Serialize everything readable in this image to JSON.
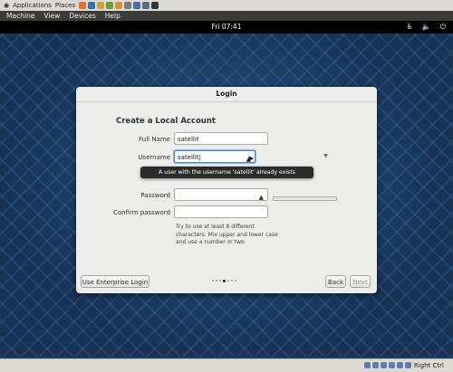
{
  "host_bar": {
    "applications": "Applications",
    "places": "Places",
    "launchers": [
      {
        "icon": "firefox-icon",
        "color": "#e2712a"
      },
      {
        "icon": "thunderbird-icon",
        "color": "#3a6fb0"
      },
      {
        "icon": "tool-icon",
        "color": "#c9a33a"
      },
      {
        "icon": "editor-icon",
        "color": "#6d9a3a"
      },
      {
        "icon": "folder-icon",
        "color": "#d7903b"
      },
      {
        "icon": "chat-icon",
        "color": "#7a7a7a"
      },
      {
        "icon": "window-icon",
        "color": "#4c6ca0"
      },
      {
        "icon": "network-icon",
        "color": "#5a6a8a"
      },
      {
        "icon": "terminal-icon",
        "color": "#333333"
      }
    ]
  },
  "vm_menu": {
    "items": [
      "Machine",
      "View",
      "Devices",
      "Help"
    ]
  },
  "top_bar": {
    "clock": "Fri 07:41",
    "icons": [
      "accessibility-icon",
      "volume-icon",
      "power-icon"
    ]
  },
  "dialog": {
    "title": "Login",
    "heading": "Create a Local Account",
    "full_name_label": "Full Name",
    "full_name_value": "satellit",
    "username_label": "Username",
    "username_value": "satellit",
    "tooltip": "A user with the username 'satellit' already exists",
    "password_label": "Password",
    "password_value": "",
    "confirm_label": "Confirm password",
    "confirm_value": "",
    "hint": "Try to use at least 8 different characters. Mix upper and lower case and use a number or two.",
    "enterprise_button": "Use Enterprise Login",
    "back_button": "Back",
    "next_button": "Next",
    "page_dots": 7,
    "active_dot": 3
  },
  "status_bar": {
    "host_key": "Right Ctrl"
  }
}
